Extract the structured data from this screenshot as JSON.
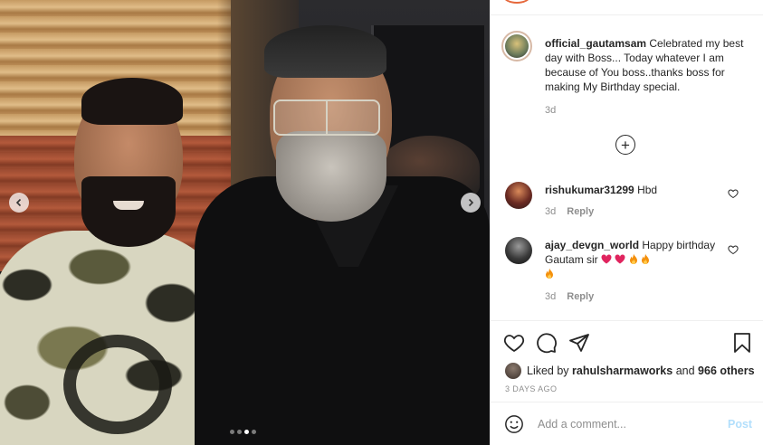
{
  "post": {
    "slide_count": 4,
    "active_slide": 3
  },
  "caption": {
    "username": "official_gautamsam",
    "text": "Celebrated my best day with Boss... Today whatever I am because of You boss..thanks boss for making My Birthday special.",
    "age": "3d"
  },
  "load_more_icon": "plus-circle-icon",
  "comments": [
    {
      "username": "rishukumar31299",
      "text": "Hbd",
      "age": "3d",
      "reply_label": "Reply"
    },
    {
      "username": "ajay_devgn_world",
      "text": "Happy birthday Gautam sir",
      "age": "3d",
      "reply_label": "Reply"
    }
  ],
  "actions": {
    "liked_by_prefix": "Liked by",
    "liked_by_user": "rahulsharmaworks",
    "and_label": "and",
    "others_count": "966 others",
    "timestamp": "3 DAYS AGO"
  },
  "add_comment": {
    "placeholder": "Add a comment...",
    "post_label": "Post"
  },
  "colors": {
    "heart_red": "#e0245e",
    "post_disabled": "#b2dffc",
    "muted": "#8e8e8e"
  }
}
